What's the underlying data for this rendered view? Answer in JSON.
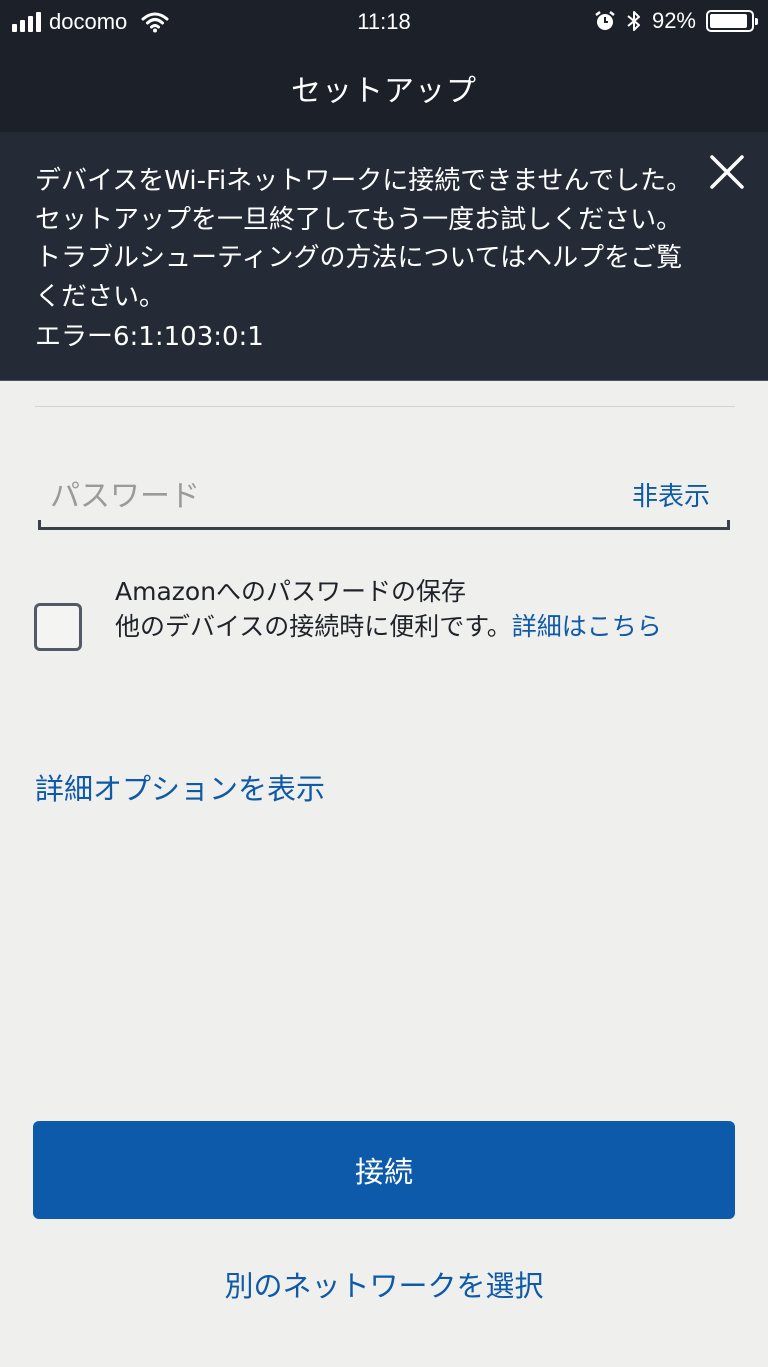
{
  "status_bar": {
    "carrier": "docomo",
    "time": "11:18",
    "battery": "92%",
    "battery_level": 0.92,
    "icons": [
      "signal-icon",
      "wifi-icon",
      "alarm-icon",
      "bluetooth-icon",
      "battery-icon"
    ]
  },
  "header": {
    "title": "セットアップ"
  },
  "error_banner": {
    "message": "デバイスをWi-Fiネットワークに接続できませんでした。セットアップを一旦終了してもう一度お試しください。トラブルシューティングの方法についてはヘルプをご覧ください。",
    "code": "エラー6:1:103:0:1",
    "close_icon": "close-icon"
  },
  "password": {
    "placeholder": "パスワード",
    "value": "",
    "toggle_label": "非表示"
  },
  "save_password": {
    "checked": false,
    "title": "Amazonへのパスワードの保存",
    "description": "他のデバイスの接続時に便利です。",
    "link": "詳細はこちら"
  },
  "advanced_options_label": "詳細オプションを表示",
  "connect_label": "接続",
  "select_network_label": "別のネットワークを選択",
  "colors": {
    "header_bg": "#1b2029",
    "banner_bg": "#252b36",
    "page_bg": "#efefed",
    "accent": "#0e5aa7",
    "button": "#0d5aab"
  }
}
